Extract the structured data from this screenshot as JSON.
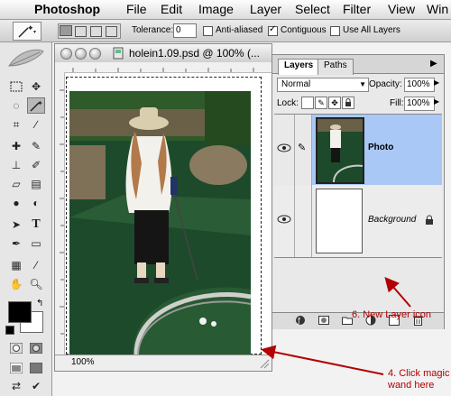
{
  "menubar": {
    "apple": "",
    "items": [
      "Photoshop",
      "File",
      "Edit",
      "Image",
      "Layer",
      "Select",
      "Filter",
      "View",
      "Win"
    ]
  },
  "options": {
    "tolerance_label": "Tolerance:",
    "tolerance_value": "0",
    "anti_aliased": "Anti-aliased",
    "anti_aliased_checked": false,
    "contiguous": "Contiguous",
    "contiguous_checked": true,
    "use_all_layers": "Use All Layers",
    "use_all_layers_checked": false
  },
  "document": {
    "title": "holein1.09.psd @ 100% (...",
    "zoom": "100%"
  },
  "layers_panel": {
    "tabs": [
      "Layers",
      "Paths"
    ],
    "blend_mode": "Normal",
    "opacity_label": "Opacity:",
    "opacity_value": "100%",
    "lock_label": "Lock:",
    "fill_label": "Fill:",
    "fill_value": "100%",
    "layers": [
      {
        "name": "Photo",
        "selected": true
      },
      {
        "name": "Background",
        "selected": false
      }
    ]
  },
  "annotations": {
    "new_layer": "6. New Layer icon",
    "magic_wand_line1": "4. Click magic",
    "magic_wand_line2": "wand here"
  },
  "colors": {
    "selected_layer": "#a9c8f5",
    "annotation": "#b30000",
    "grass": "#1f4d2e"
  },
  "icons": [
    "apple-icon",
    "magic-wand-icon",
    "layer-mask-icon",
    "eye-icon",
    "brush-icon",
    "lock-icon",
    "new-layer-icon",
    "trash-icon",
    "folder-icon",
    "adjustment-icon",
    "layer-style-icon"
  ]
}
